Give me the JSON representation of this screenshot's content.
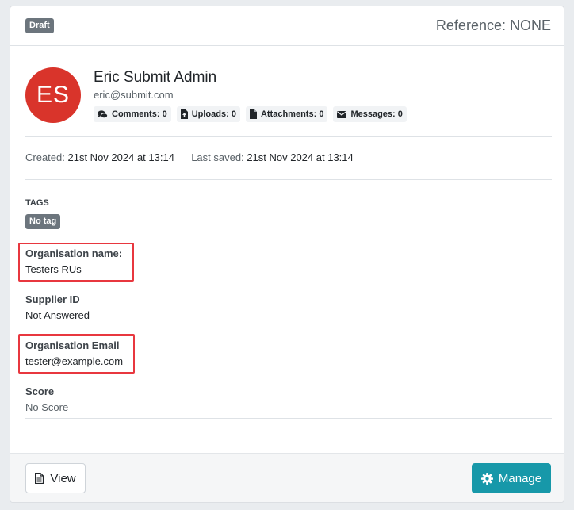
{
  "header": {
    "status_badge": "Draft",
    "reference_label": "Reference:",
    "reference_value": "NONE"
  },
  "user": {
    "initials": "ES",
    "name": "Eric Submit Admin",
    "email": "eric@submit.com",
    "avatar_color": "#d9342b"
  },
  "counters": [
    {
      "icon": "comments-icon",
      "label": "Comments:",
      "value": "0"
    },
    {
      "icon": "upload-icon",
      "label": "Uploads:",
      "value": "0"
    },
    {
      "icon": "attachment-icon",
      "label": "Attachments:",
      "value": "0"
    },
    {
      "icon": "envelope-icon",
      "label": "Messages:",
      "value": "0"
    }
  ],
  "dates": {
    "created_label": "Created:",
    "created_value": "21st Nov 2024 at 13:14",
    "saved_label": "Last saved:",
    "saved_value": "21st Nov 2024 at 13:14"
  },
  "tags": {
    "label": "TAGS",
    "badge": "No tag"
  },
  "fields": [
    {
      "label": "Organisation name:",
      "value": "Testers RUs"
    },
    {
      "label": "Supplier ID",
      "value": "Not Answered"
    },
    {
      "label": "Organisation Email",
      "value": "tester@example.com"
    },
    {
      "label": "Score",
      "value": "No Score"
    }
  ],
  "footer": {
    "view_label": "View",
    "manage_label": "Manage",
    "manage_color": "#1798a9",
    "highlight_color": "#e8373f"
  }
}
